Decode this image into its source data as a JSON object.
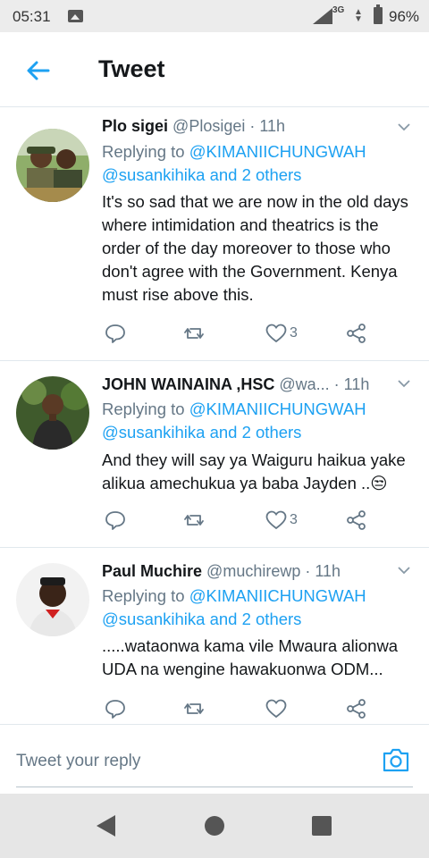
{
  "status_bar": {
    "time": "05:31",
    "network": "3G",
    "battery": "96%"
  },
  "header": {
    "title": "Tweet"
  },
  "tweets": [
    {
      "name": "Plo sigei",
      "handle": "@Plosigei",
      "time": "· 11h",
      "replying_prefix": "Replying to ",
      "replying_to": "@KIMANIICHUNGWAH",
      "replying_more": "@susankihika and 2 others",
      "text": "It's so sad that we are now in the old days where intimidation and theatrics is the order of the day moreover to those who don't agree with the Government. Kenya must rise above this.",
      "likes": "3"
    },
    {
      "name": "JOHN WAINAINA ,HSC",
      "handle": "@wa...",
      "time": "· 11h",
      "replying_prefix": "Replying to ",
      "replying_to": "@KIMANIICHUNGWAH",
      "replying_more": "@susankihika and 2 others",
      "text": "And they will say ya Waiguru haikua yake alikua amechukua ya baba Jayden ..😒",
      "likes": "3"
    },
    {
      "name": "Paul Muchire",
      "handle": "@muchirewp",
      "time": "· 11h",
      "replying_prefix": "Replying to ",
      "replying_to": "@KIMANIICHUNGWAH",
      "replying_more": "@susankihika and 2 others",
      "text": ".....wataonwa kama vile Mwaura alionwa UDA na wengine hawakuonwa ODM...",
      "likes": ""
    }
  ],
  "reply_bar": {
    "placeholder": "Tweet your reply"
  },
  "icons": {
    "back": "arrow-left-icon",
    "caret": "chevron-down-icon",
    "reply": "reply-icon",
    "retweet": "retweet-icon",
    "like": "heart-icon",
    "share": "share-icon",
    "camera": "camera-icon"
  },
  "colors": {
    "accent": "#1da1f2",
    "text": "#14171a",
    "muted": "#657786",
    "divider": "#e1e8ed"
  }
}
